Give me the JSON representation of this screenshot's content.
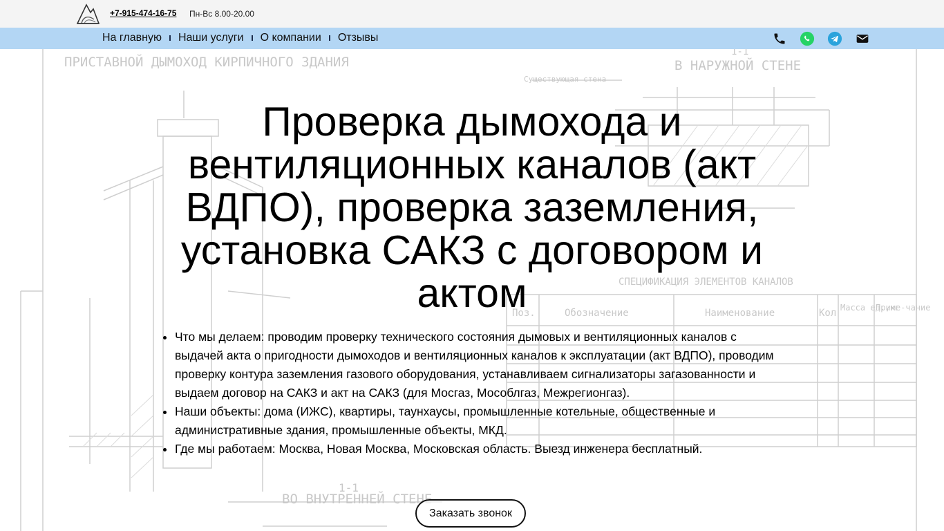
{
  "header": {
    "phone": "+7-915-474-16-75",
    "hours": "Пн-Вс 8.00-20.00"
  },
  "nav": {
    "items": [
      "На главную",
      "Наши услуги",
      "О компании",
      "Отзывы"
    ]
  },
  "contacts": {
    "icons": [
      "phone-icon",
      "whatsapp-icon",
      "telegram-icon",
      "mail-icon"
    ],
    "colors": {
      "whatsapp": "#25d366",
      "telegram": "#2aa3dc"
    }
  },
  "hero": {
    "title": "Проверка дымохода и вентиляционных каналов (акт ВДПО), проверка заземления, установка САКЗ с договором и актом",
    "bullets": [
      "Что мы делаем: проводим проверку технического состояния дымовых и вентиляционных каналов с выдачей акта о пригодности дымоходов и вентиляционных каналов к эксплуатации (акт ВДПО), проводим проверку контура заземления газового оборудования, устанавливаем сигнализаторы загазованности и выдаем договор на САКЗ и акт на САКЗ (для Мосгаз, Мособлгаз, Межрегионгаз).",
      "Наши объекты: дома (ИЖС), квартиры, таунхаусы, промышленные котельные, общественные и административные здания, промышленные объекты, МКД.",
      "Где мы работаем: Москва, Новая Москва, Московская область. Выезд инженера бесплатный."
    ],
    "cta_label": "Заказать звонок"
  },
  "drawing": {
    "labels": [
      "ПРИСТАВНОЙ ДЫМОХОД КИРПИЧНОГО ЗДАНИЯ",
      "В НАРУЖНОЙ СТЕНЕ",
      "Существующая стена",
      "СПЕЦИФИКАЦИЯ ЭЛЕМЕНТОВ КАНАЛОВ",
      "ВО ВНУТРЕННЕЙ СТЕНЕ",
      "1-1",
      "1-1"
    ],
    "table_headers": [
      "Поз.",
      "Обозначение",
      "Наименование",
      "Кол",
      "Масса ед.,кг",
      "Приме-чание"
    ]
  }
}
